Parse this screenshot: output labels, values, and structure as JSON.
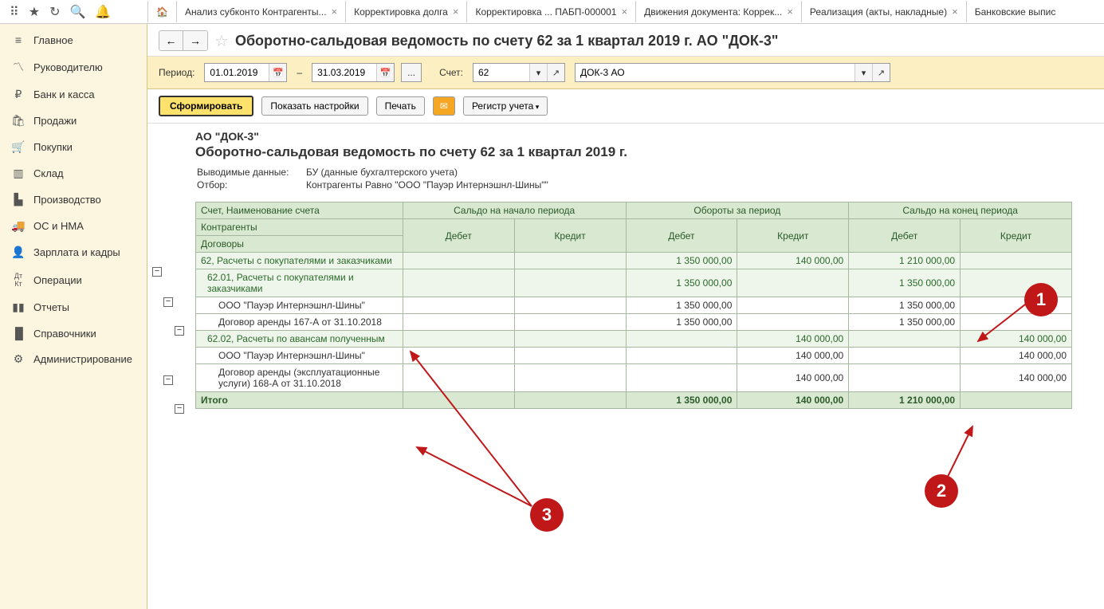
{
  "toolbar_icons": [
    "apps",
    "star",
    "clock",
    "search",
    "bell"
  ],
  "tabs": [
    {
      "label": "",
      "icon": "home"
    },
    {
      "label": "Анализ субконто Контрагенты..."
    },
    {
      "label": "Корректировка долга"
    },
    {
      "label": "Корректировка ... ПАБП-000001"
    },
    {
      "label": "Движения документа: Коррек..."
    },
    {
      "label": "Реализация (акты, накладные)"
    },
    {
      "label": "Банковские выпис"
    }
  ],
  "sidebar": [
    {
      "icon": "≡",
      "label": "Главное"
    },
    {
      "icon": "📈",
      "label": "Руководителю"
    },
    {
      "icon": "₽",
      "label": "Банк и касса"
    },
    {
      "icon": "🛍",
      "label": "Продажи"
    },
    {
      "icon": "🛒",
      "label": "Покупки"
    },
    {
      "icon": "🏢",
      "label": "Склад"
    },
    {
      "icon": "📊",
      "label": "Производство"
    },
    {
      "icon": "🚚",
      "label": "ОС и НМА"
    },
    {
      "icon": "👤",
      "label": "Зарплата и кадры"
    },
    {
      "icon": "ДтКт",
      "label": "Операции"
    },
    {
      "icon": "📊",
      "label": "Отчеты"
    },
    {
      "icon": "📚",
      "label": "Справочники"
    },
    {
      "icon": "⚙",
      "label": "Администрирование"
    }
  ],
  "title": "Оборотно-сальдовая ведомость по счету 62 за 1 квартал 2019 г. АО \"ДОК-3\"",
  "filters": {
    "period_label": "Период:",
    "date_from": "01.01.2019",
    "date_to": "31.03.2019",
    "account_label": "Счет:",
    "account": "62",
    "org": "ДОК-3 АО"
  },
  "actions": {
    "generate": "Сформировать",
    "settings": "Показать настройки",
    "print": "Печать",
    "registry": "Регистр учета"
  },
  "report": {
    "org": "АО \"ДОК-3\"",
    "title": "Оборотно-сальдовая ведомость по счету 62 за 1 квартал 2019 г.",
    "meta1_label": "Выводимые данные:",
    "meta1_value": "БУ (данные бухгалтерского учета)",
    "meta2_label": "Отбор:",
    "meta2_value": "Контрагенты Равно \"ООО \"Пауэр Интернэшнл-Шины\"\"",
    "headers": {
      "account": "Счет, Наименование счета",
      "counterparties": "Контрагенты",
      "contracts": "Договоры",
      "open": "Сальдо на начало периода",
      "turn": "Обороты за период",
      "close": "Сальдо на конец периода",
      "debit": "Дебет",
      "credit": "Кредит"
    },
    "rows": [
      {
        "lvl": 0,
        "name": "62, Расчеты с покупателями и заказчиками",
        "td": "1 350 000,00",
        "tc": "140 000,00",
        "cd": "1 210 000,00"
      },
      {
        "lvl": 1,
        "name": "62.01, Расчеты с покупателями и заказчиками",
        "td": "1 350 000,00",
        "cd": "1 350 000,00"
      },
      {
        "lvl": 2,
        "name": "ООО \"Пауэр Интернэшнл-Шины\"",
        "td": "1 350 000,00",
        "cd": "1 350 000,00"
      },
      {
        "lvl": 3,
        "name": "Договор аренды 167-А от 31.10.2018",
        "td": "1 350 000,00",
        "cd": "1 350 000,00"
      },
      {
        "lvl": 1,
        "name": "62.02, Расчеты по авансам полученным",
        "tc": "140 000,00",
        "cc": "140 000,00"
      },
      {
        "lvl": 2,
        "name": "ООО \"Пауэр Интернэшнл-Шины\"",
        "tc": "140 000,00",
        "cc": "140 000,00"
      },
      {
        "lvl": 3,
        "name": "Договор аренды (эксплуатационные услуги) 168-А от 31.10.2018",
        "tc": "140 000,00",
        "cc": "140 000,00"
      }
    ],
    "total": {
      "label": "Итого",
      "td": "1 350 000,00",
      "tc": "140 000,00",
      "cd": "1 210 000,00"
    }
  },
  "callouts": {
    "c1": "1",
    "c2": "2",
    "c3": "3"
  }
}
